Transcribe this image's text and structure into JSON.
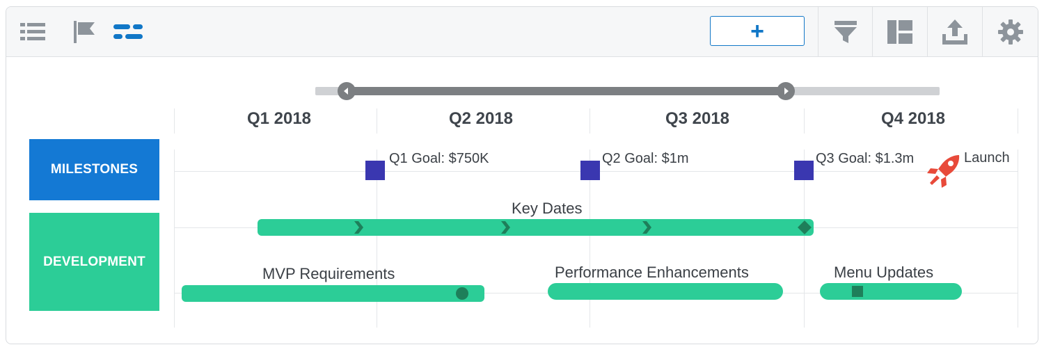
{
  "toolbar": {
    "add_label": "+",
    "colors": {
      "active": "#1177c7",
      "inactive": "#8d949b"
    },
    "icons": [
      "list-view-icon",
      "milestone-flag-icon",
      "timeline-view-icon",
      "filter-icon",
      "layout-icon",
      "export-icon",
      "settings-icon"
    ]
  },
  "lanes": [
    {
      "label": "MILESTONES",
      "color": "#1479d4"
    },
    {
      "label": "DEVELOPMENT",
      "color": "#2ccd97"
    }
  ],
  "timeline": {
    "quarters": [
      "Q1 2018",
      "Q2 2018",
      "Q3 2018",
      "Q4 2018"
    ],
    "range_slider": {
      "start_quarter": "Q1 2018",
      "end_quarter": "Q3 2018"
    }
  },
  "milestones": [
    {
      "label": "Q1 Goal: $750K",
      "color": "#3a37b0",
      "icon": "square-marker-icon"
    },
    {
      "label": "Q2 Goal: $1m",
      "color": "#3a37b0",
      "icon": "square-marker-icon"
    },
    {
      "label": "Q3 Goal: $1.3m",
      "color": "#3a37b0",
      "icon": "square-marker-icon"
    },
    {
      "label": "Launch",
      "color": "#e84a3a",
      "icon": "rocket-icon"
    }
  ],
  "development": [
    {
      "label": "Key Dates",
      "marker": "chevron-and-diamond"
    },
    {
      "label": "MVP Requirements",
      "marker": "circle"
    },
    {
      "label": "Performance Enhancements",
      "marker": "none"
    },
    {
      "label": "Menu Updates",
      "marker": "square"
    }
  ]
}
